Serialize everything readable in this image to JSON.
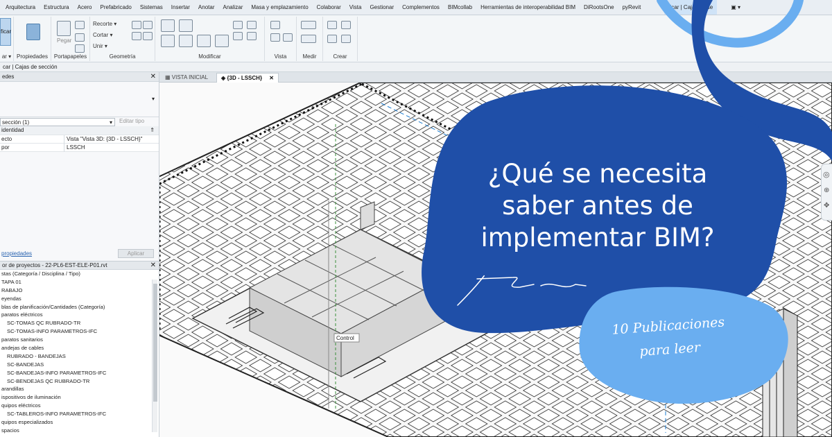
{
  "menubar": {
    "tabs": [
      "Arquitectura",
      "Estructura",
      "Acero",
      "Prefabricado",
      "Sistemas",
      "Insertar",
      "Anotar",
      "Analizar",
      "Masa y emplazamiento",
      "Colaborar",
      "Vista",
      "Gestionar",
      "Complementos",
      "BIMcollab",
      "Herramientas de interoperabilidad BIM",
      "DiRootsOne",
      "pyRevit"
    ],
    "context_tab": "ficar | Cajas de se",
    "extra": "▣ ▾"
  },
  "ribbon": {
    "modify_button": "ficar",
    "panels": {
      "select": "ar ▾",
      "properties": "Propiedades",
      "clipboard": "Portapapeles",
      "geometry": "Geometría",
      "modify": "Modificar",
      "view": "Vista",
      "measure": "Medir",
      "create": "Crear"
    },
    "clipboard": {
      "paste": "Pegar",
      "cut": "Recorte ▾",
      "copy": "Cortar ▾",
      "join": "Unir ▾"
    }
  },
  "optbar": {
    "text": "car | Cajas de sección"
  },
  "properties": {
    "title": "edes",
    "type_selector": "sección (1)",
    "edit_type": "Editar tipo",
    "group": "identidad",
    "rows": [
      {
        "label": "ecto",
        "value": "Vista \"Vista 3D: {3D - LSSCH}\""
      },
      {
        "label": "por",
        "value": "LSSCH"
      }
    ],
    "help_link": "propiedades",
    "apply": "Aplicar"
  },
  "browser": {
    "title": "or de proyectos - 22-PL6-EST-ELE-P01.rvt",
    "items": [
      {
        "text": "stas (Categoría / Disciplina / Tipo)",
        "level": 1
      },
      {
        "text": "TAPA 01",
        "level": 1
      },
      {
        "text": "RABAJO",
        "level": 1
      },
      {
        "text": "eyendas",
        "level": 1
      },
      {
        "text": "blas de planificación/Cantidades (Categoría)",
        "level": 1
      },
      {
        "text": "paratos eléctricos",
        "level": 1
      },
      {
        "text": "SC-TOMAS QC RUBRADO-TR",
        "level": 2
      },
      {
        "text": "SC-TOMAS-INFO PARAMETROS-IFC",
        "level": 2
      },
      {
        "text": "paratos sanitarios",
        "level": 1
      },
      {
        "text": "andejas de cables",
        "level": 1
      },
      {
        "text": "RUBRADO - BANDEJAS",
        "level": 2
      },
      {
        "text": "SC-BANDEJAS",
        "level": 2
      },
      {
        "text": "SC-BANDEJAS-INFO PARAMETROS-IFC",
        "level": 2
      },
      {
        "text": "SC-BENDEJAS QC RUBRADO-TR",
        "level": 2
      },
      {
        "text": "arandillas",
        "level": 1
      },
      {
        "text": "ispositivos de iluminación",
        "level": 1
      },
      {
        "text": "quipos eléctricos",
        "level": 1
      },
      {
        "text": "SC-TABLEROS-INFO PARAMETROS-IFC",
        "level": 2
      },
      {
        "text": "quipos especializados",
        "level": 1
      },
      {
        "text": "spacios",
        "level": 1
      }
    ]
  },
  "view": {
    "tabs": [
      {
        "label": "VISTA INICIAL",
        "active": false
      },
      {
        "label": "{3D - LSSCH}",
        "active": true
      }
    ],
    "control_tag": "Control"
  },
  "overlay": {
    "headline": [
      "¿Qué se necesita",
      "saber antes de",
      "implementar BIM?"
    ],
    "publications": [
      "10 Publicaciones",
      "para leer"
    ],
    "colors": {
      "dark_blue": "#1f4fa8",
      "light_blue": "#6aaef0",
      "ribbon_blue": "#cfe3f7"
    }
  }
}
